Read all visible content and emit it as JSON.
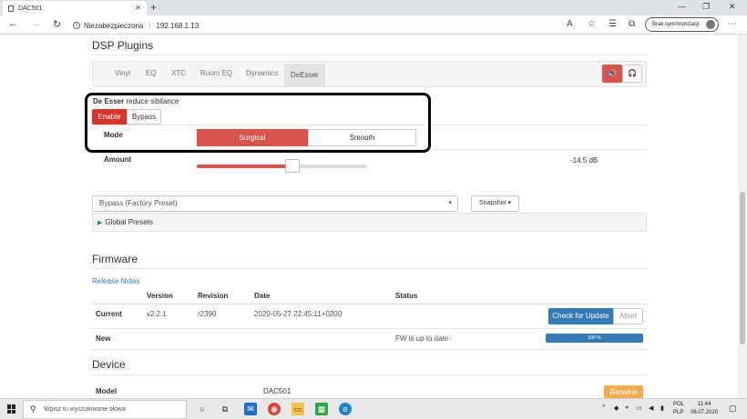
{
  "browser": {
    "tab_title": "DAC501",
    "new_tab": "+",
    "tab_close": "✕",
    "security_label": "Niezabezpieczona",
    "url": "192.168.1.13",
    "sync_label": "Brak synchronizacji",
    "window_controls": [
      "—",
      "❐",
      "✕"
    ]
  },
  "dsp": {
    "heading": "DSP Plugins",
    "tabs": [
      "Vinyl",
      "EQ",
      "XTC",
      "Room EQ",
      "Dynamics",
      "DeEsser"
    ],
    "active_tab": "DeEsser",
    "plugin_name": "De Esser",
    "plugin_desc": "reduce sibilance",
    "enable_label": "Enable",
    "bypass_label": "Bypass",
    "mode_label": "Mode",
    "mode_options": [
      "Surgical",
      "Smooth"
    ],
    "mode_selected": "Surgical",
    "amount_label": "Amount",
    "amount_value": "-14.5 dB",
    "amount_slider_fraction": 0.56,
    "preset_value": "Bypass (Factory Preset)",
    "snapshot_label": "Snapshot ▾",
    "global_presets_label": "Global Presets"
  },
  "firmware": {
    "heading": "Firmware",
    "release_notes": "Release Notes",
    "columns": [
      "Version",
      "Revision",
      "Date",
      "Status"
    ],
    "current": {
      "label": "Current",
      "version": "v2.2.1",
      "revision": "r2390",
      "date": "2020-05-27 22:45:11+0200"
    },
    "new": {
      "label": "New",
      "status": "FW is up to date",
      "progress_label": "100 %",
      "progress_fraction": 1.0
    },
    "check_button": "Check for Update",
    "abort_button": "Abort"
  },
  "device": {
    "heading": "Device",
    "model_label": "Model",
    "model_value": "DAC501",
    "rename_button": "Rename"
  },
  "taskbar": {
    "search_placeholder": "Wpisz tu wyszukiwane słowa",
    "lang_top": "POL",
    "lang_bottom": "PLP",
    "time": "11:44",
    "date": "06.07.2020"
  },
  "colors": {
    "accent_red": "#d9534f",
    "primary_blue": "#337ab7",
    "warning_orange": "#f0ad4e"
  }
}
